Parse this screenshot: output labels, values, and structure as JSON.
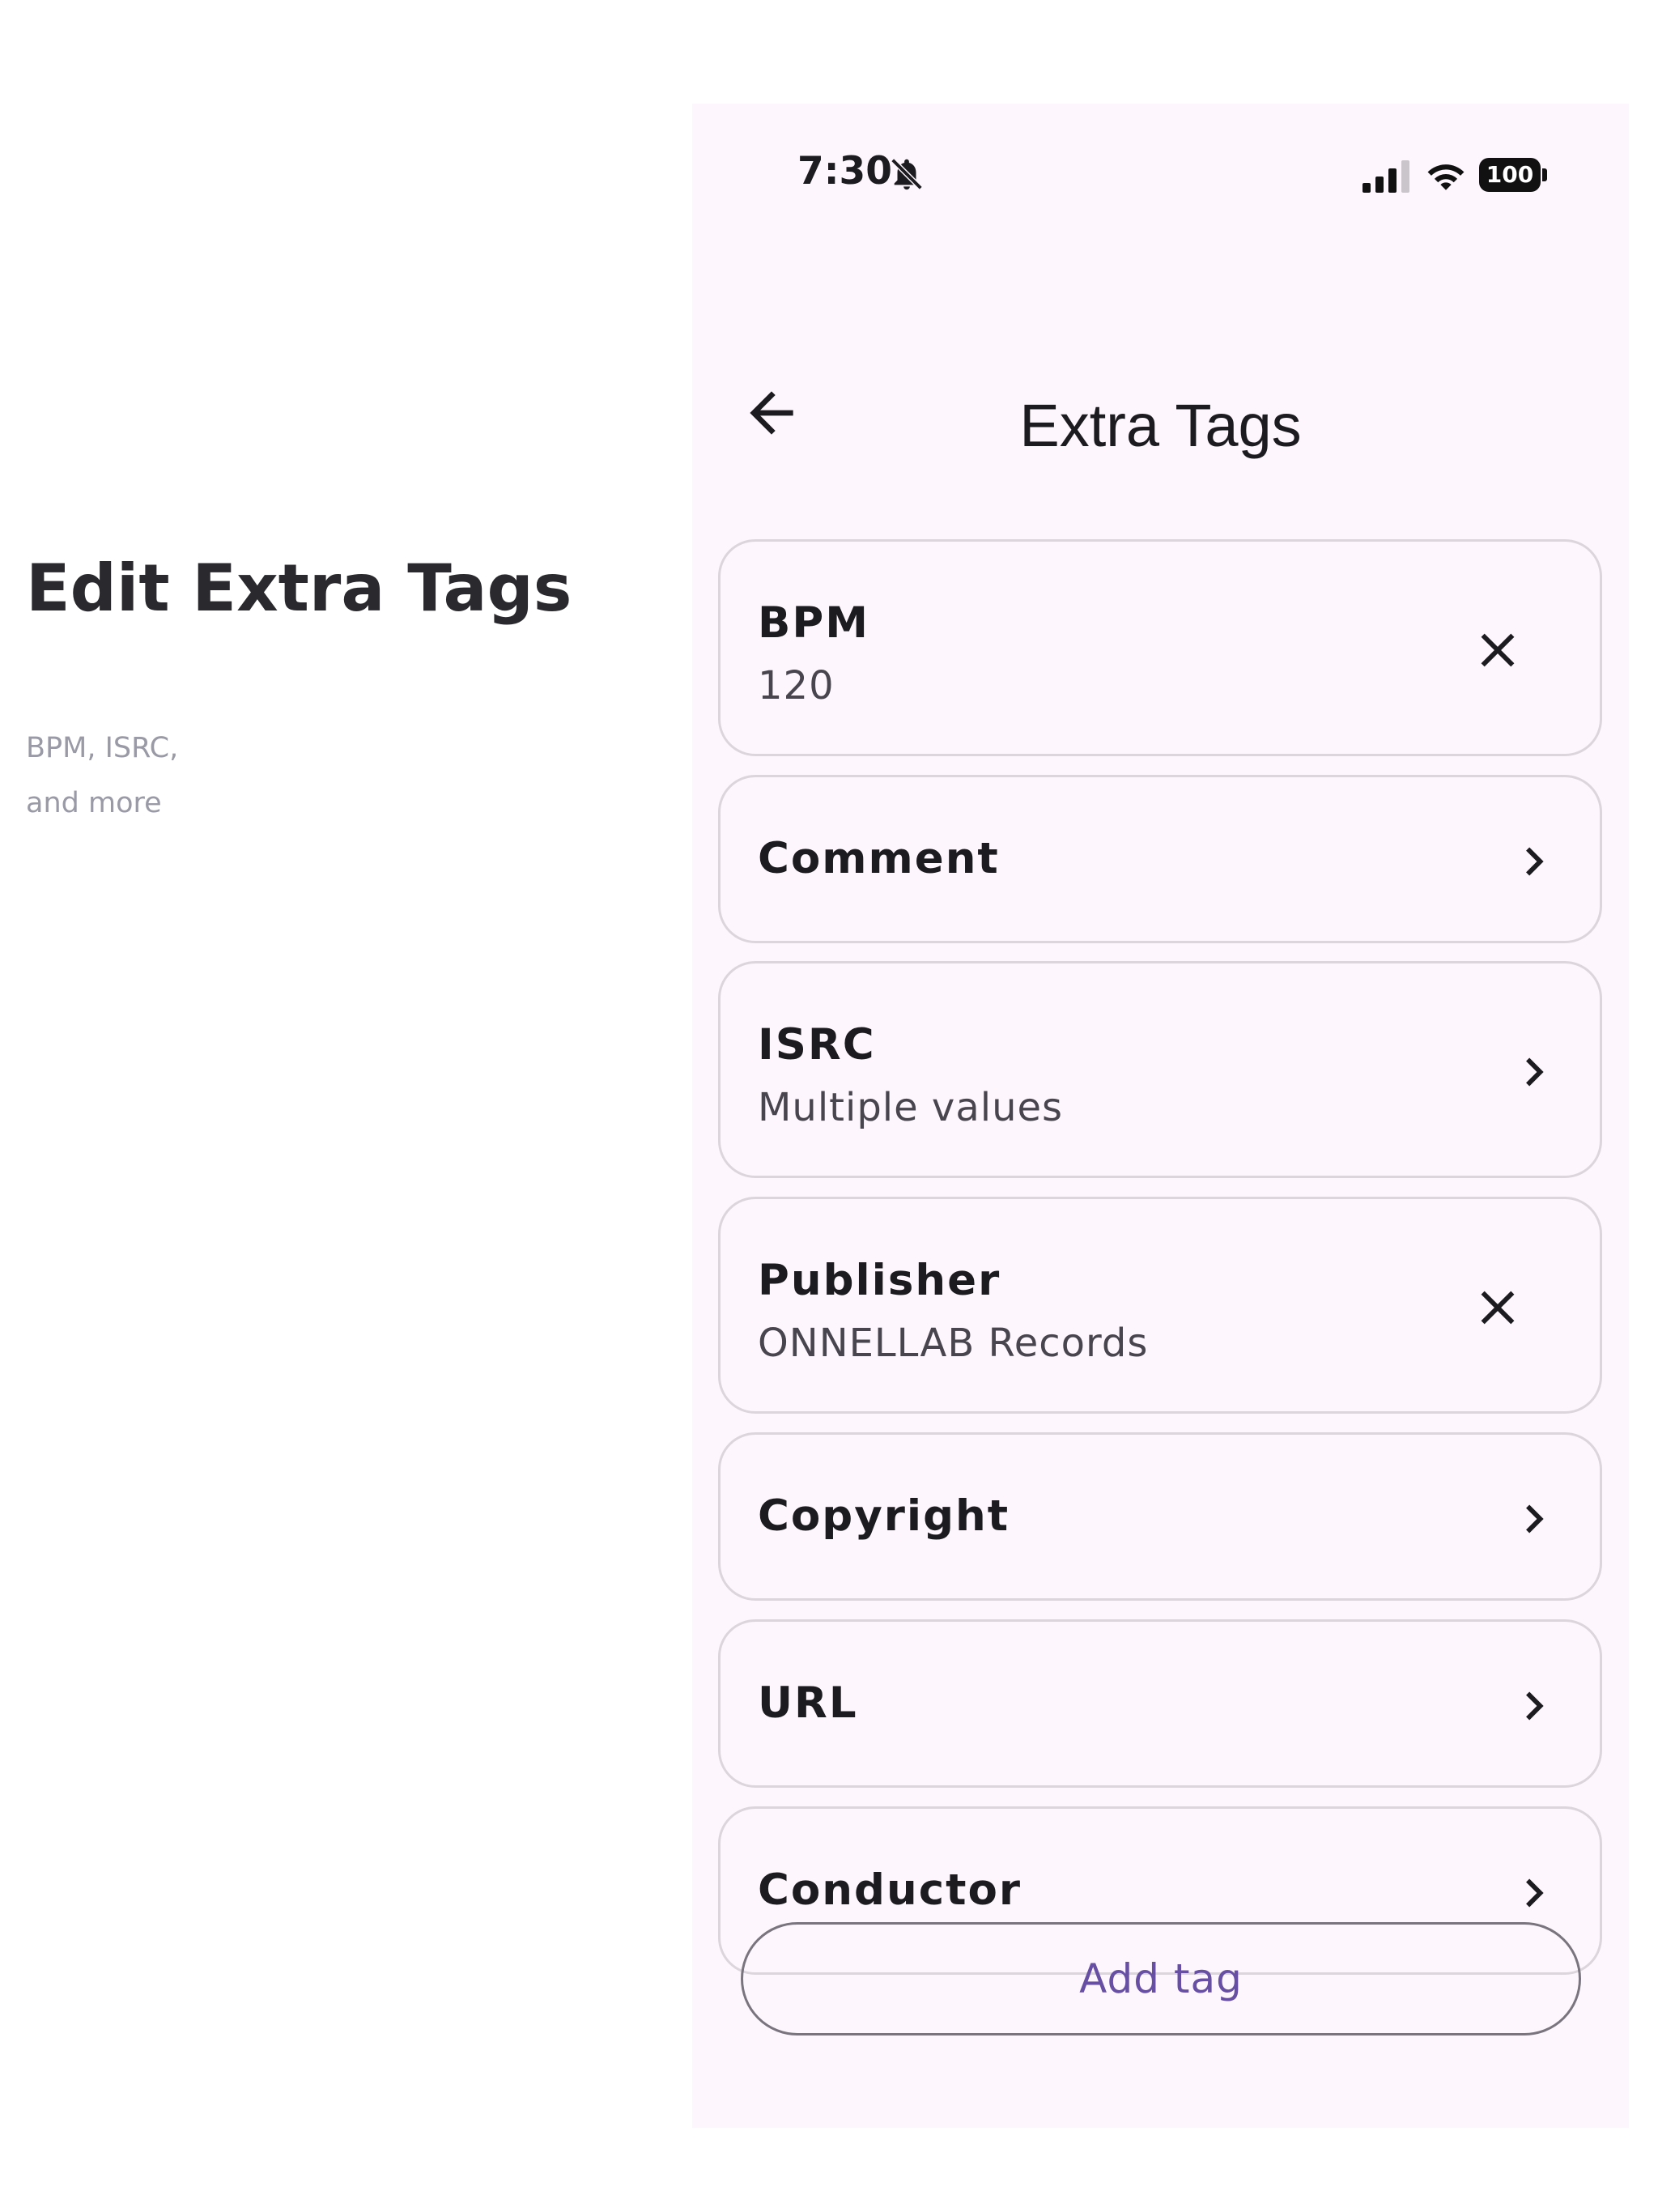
{
  "promo": {
    "title": "Edit Extra Tags",
    "subtitle": "BPM, ISRC, and more"
  },
  "status_bar": {
    "time": "7:30",
    "battery": "100",
    "icons": [
      "bell-off-icon",
      "signal-icon",
      "wifi-icon",
      "battery-icon"
    ]
  },
  "top_bar": {
    "title": "Extra Tags",
    "back_icon": "arrow-back-icon"
  },
  "tags": [
    {
      "name": "BPM",
      "value": "120",
      "action": "close-icon"
    },
    {
      "name": "Comment",
      "value": "",
      "action": "chevron-right-icon"
    },
    {
      "name": "ISRC",
      "value": "Multiple values",
      "action": "chevron-right-icon"
    },
    {
      "name": "Publisher",
      "value": "ONNELLAB Records",
      "action": "close-icon"
    },
    {
      "name": "Copyright",
      "value": "",
      "action": "chevron-right-icon"
    },
    {
      "name": "URL",
      "value": "",
      "action": "chevron-right-icon"
    },
    {
      "name": "Conductor",
      "value": "",
      "action": "chevron-right-icon"
    }
  ],
  "add_button": {
    "label": "Add tag"
  },
  "colors": {
    "screen_background": "#fdf7fd",
    "card_border": "#dcd6dc",
    "accent": "#6750a4",
    "text_primary": "#1c1b1f",
    "text_secondary": "#49454f",
    "promo_subtitle": "#9a9aa6"
  }
}
